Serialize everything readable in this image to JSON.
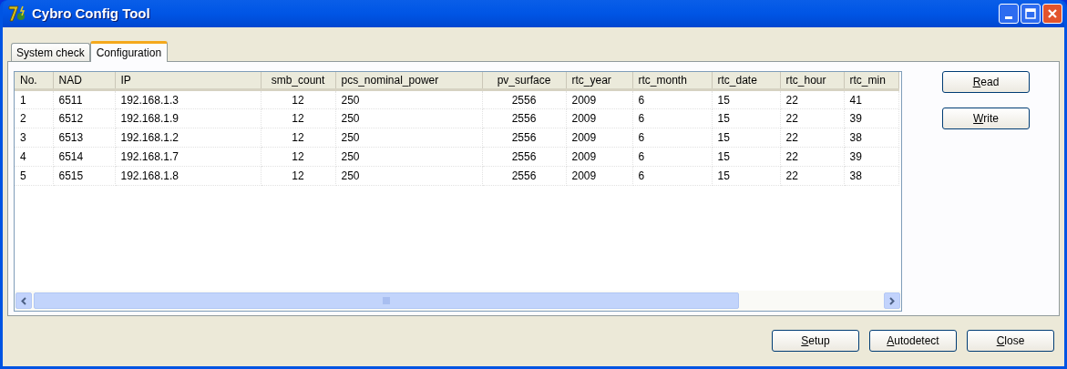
{
  "window": {
    "title": "Cybro Config Tool"
  },
  "tabs": [
    {
      "label": "System check",
      "selected": false
    },
    {
      "label": "Configuration",
      "selected": true
    }
  ],
  "table": {
    "columns": [
      "No.",
      "NAD",
      "IP",
      "smb_count",
      "pcs_nominal_power",
      "pv_surface",
      "rtc_year",
      "rtc_month",
      "rtc_date",
      "rtc_hour",
      "rtc_min"
    ],
    "rows": [
      [
        "1",
        "6511",
        "192.168.1.3",
        "12",
        "250",
        "2556",
        "2009",
        "6",
        "15",
        "22",
        "41"
      ],
      [
        "2",
        "6512",
        "192.168.1.9",
        "12",
        "250",
        "2556",
        "2009",
        "6",
        "15",
        "22",
        "39"
      ],
      [
        "3",
        "6513",
        "192.168.1.2",
        "12",
        "250",
        "2556",
        "2009",
        "6",
        "15",
        "22",
        "38"
      ],
      [
        "4",
        "6514",
        "192.168.1.7",
        "12",
        "250",
        "2556",
        "2009",
        "6",
        "15",
        "22",
        "39"
      ],
      [
        "5",
        "6515",
        "192.168.1.8",
        "12",
        "250",
        "2556",
        "2009",
        "6",
        "15",
        "22",
        "38"
      ]
    ]
  },
  "side_buttons": [
    {
      "label": "Read",
      "underline_first": true
    },
    {
      "label": "Write",
      "underline_first": true
    }
  ],
  "bottom_buttons": [
    {
      "label": "Setup",
      "underline_first": true
    },
    {
      "label": "Autodetect",
      "underline_first": true
    },
    {
      "label": "Close",
      "underline_first": true
    }
  ]
}
